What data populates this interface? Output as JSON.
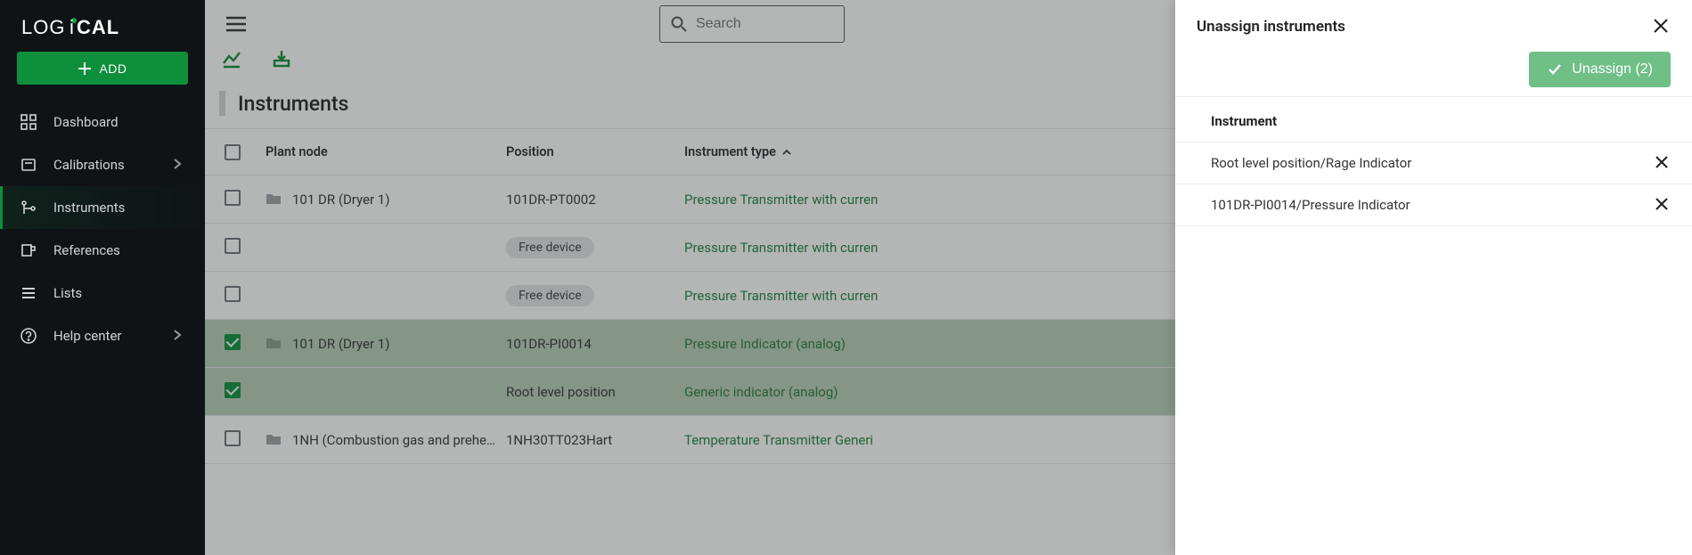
{
  "sidebar": {
    "add_label": "ADD",
    "items": [
      {
        "label": "Dashboard"
      },
      {
        "label": "Calibrations"
      },
      {
        "label": "Instruments"
      },
      {
        "label": "References"
      },
      {
        "label": "Lists"
      },
      {
        "label": "Help center"
      }
    ]
  },
  "topbar": {
    "search_placeholder": "Search"
  },
  "main": {
    "title": "Instruments",
    "columns": [
      "Plant node",
      "Position",
      "Instrument type"
    ],
    "rows": [
      {
        "selected": false,
        "plant_node": "101 DR (Dryer 1)",
        "position": "101DR-PT0002",
        "instrument_type": "Pressure Transmitter with curren"
      },
      {
        "selected": false,
        "plant_node": "",
        "position": "Free device",
        "instrument_type": "Pressure Transmitter with curren"
      },
      {
        "selected": false,
        "plant_node": "",
        "position": "Free device",
        "instrument_type": "Pressure Transmitter with curren"
      },
      {
        "selected": true,
        "plant_node": "101 DR (Dryer 1)",
        "position": "101DR-PI0014",
        "instrument_type": "Pressure Indicator (analog)"
      },
      {
        "selected": true,
        "plant_node": "",
        "position": "Root level position",
        "instrument_type": "Generic indicator (analog)"
      },
      {
        "selected": false,
        "plant_node": "1NH (Combustion gas and prehe…",
        "position": "1NH30TT023Hart",
        "instrument_type": "Temperature Transmitter Generi"
      }
    ]
  },
  "panel": {
    "title": "Unassign instruments",
    "action_label": "Unassign (2)",
    "column": "Instrument",
    "items": [
      "Root level position/Rage Indicator",
      "101DR-PI0014/Pressure Indicator"
    ]
  }
}
